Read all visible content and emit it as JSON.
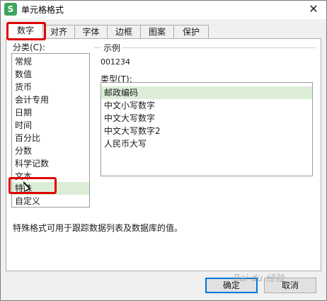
{
  "window": {
    "title": "单元格格式",
    "app_icon_letter": "S",
    "close_glyph": "✕"
  },
  "tabs": [
    "数字",
    "对齐",
    "字体",
    "边框",
    "图案",
    "保护"
  ],
  "category": {
    "label": "分类(C):",
    "items": [
      "常规",
      "数值",
      "货币",
      "会计专用",
      "日期",
      "时间",
      "百分比",
      "分数",
      "科学记数",
      "文本",
      "特殊",
      "自定义"
    ],
    "selected": "特殊"
  },
  "sample": {
    "label": "示例",
    "value": "001234"
  },
  "type": {
    "label": "类型(T):",
    "items": [
      "邮政编码",
      "中文小写数字",
      "中文大写数字",
      "中文大写数字2",
      "人民币大写"
    ],
    "selected": "邮政编码"
  },
  "description": "特殊格式可用于跟踪数据列表及数据库的值。",
  "buttons": {
    "ok": "确定",
    "cancel": "取消"
  },
  "watermark": "Bai du 经验",
  "colors": {
    "highlight": "#e00000",
    "selection": "#dceed8",
    "app_icon": "#3aa55b"
  }
}
